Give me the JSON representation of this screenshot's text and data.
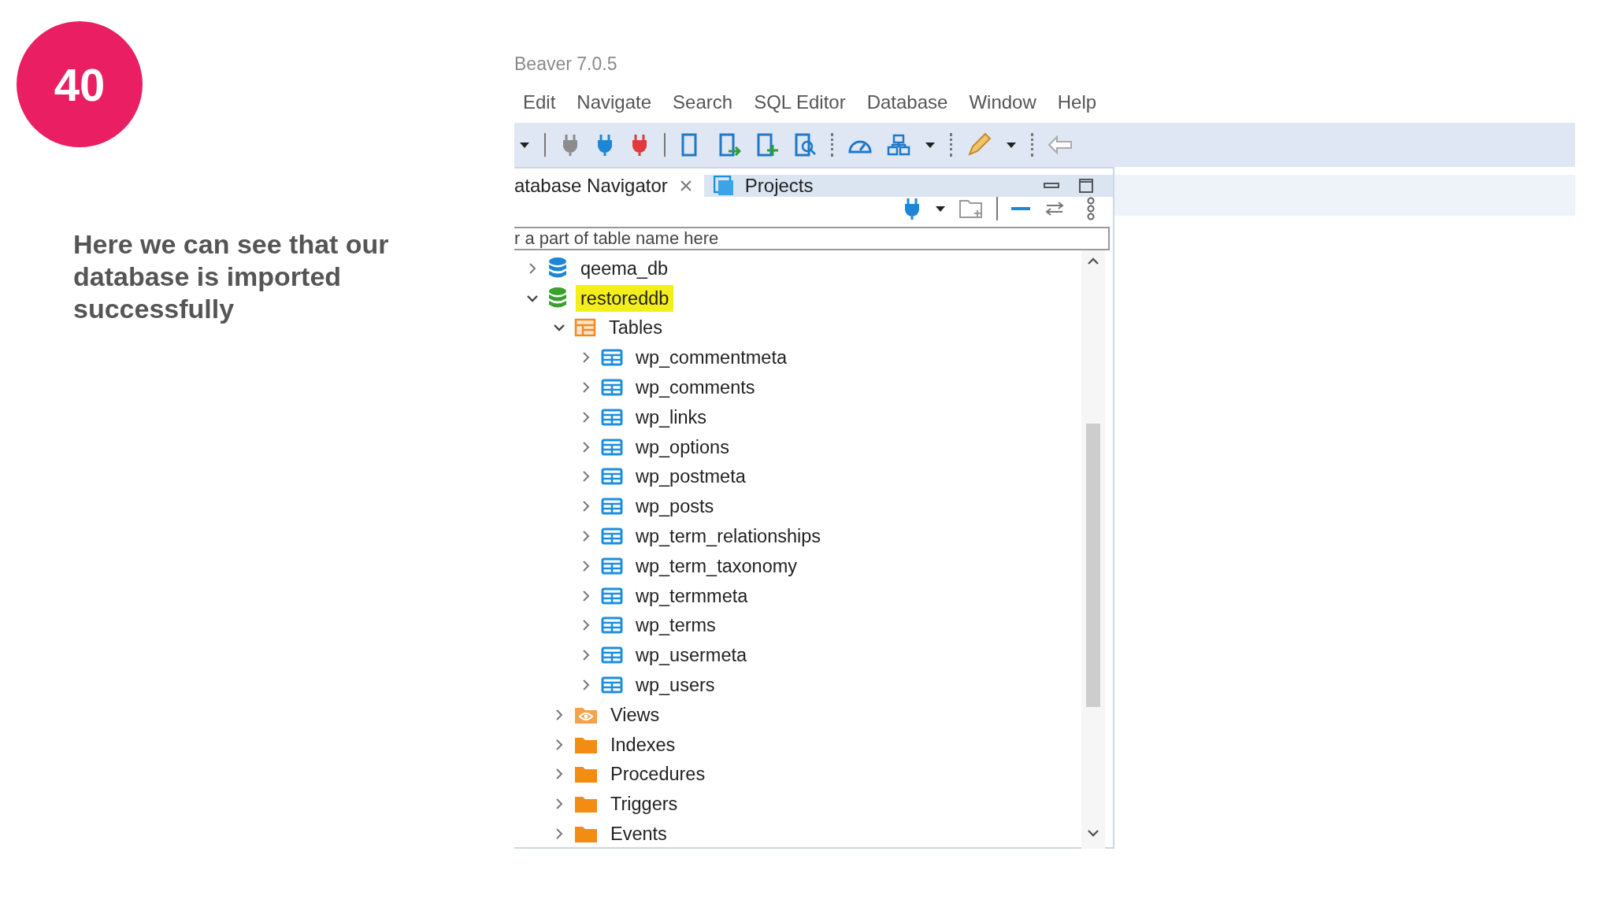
{
  "slide": {
    "number": "40",
    "caption": "Here we can see that our database is imported successfully"
  },
  "app": {
    "title": "Beaver 7.0.5",
    "menu": [
      "Edit",
      "Navigate",
      "Search",
      "SQL Editor",
      "Database",
      "Window",
      "Help"
    ],
    "tabs": [
      {
        "label": "atabase Navigator",
        "selected": true,
        "closable": true
      },
      {
        "label": "Projects",
        "selected": false,
        "closable": false
      }
    ],
    "filter": {
      "placeholder": "r a part of table name here"
    },
    "tree": [
      {
        "label": "qeema_db",
        "kind": "database",
        "connected": false,
        "expanded": false,
        "highlighted": false
      },
      {
        "label": "restoreddb",
        "kind": "database",
        "connected": true,
        "expanded": true,
        "highlighted": true,
        "children": [
          {
            "label": "Tables",
            "kind": "tables",
            "expanded": true,
            "highlighted": false,
            "children": [
              {
                "label": "wp_commentmeta",
                "kind": "table",
                "expanded": false,
                "highlighted": false
              },
              {
                "label": "wp_comments",
                "kind": "table",
                "expanded": false,
                "highlighted": false
              },
              {
                "label": "wp_links",
                "kind": "table",
                "expanded": false,
                "highlighted": false
              },
              {
                "label": "wp_options",
                "kind": "table",
                "expanded": false,
                "highlighted": false
              },
              {
                "label": "wp_postmeta",
                "kind": "table",
                "expanded": false,
                "highlighted": false
              },
              {
                "label": "wp_posts",
                "kind": "table",
                "expanded": false,
                "highlighted": false
              },
              {
                "label": "wp_term_relationships",
                "kind": "table",
                "expanded": false,
                "highlighted": false
              },
              {
                "label": "wp_term_taxonomy",
                "kind": "table",
                "expanded": false,
                "highlighted": false
              },
              {
                "label": "wp_termmeta",
                "kind": "table",
                "expanded": false,
                "highlighted": false
              },
              {
                "label": "wp_terms",
                "kind": "table",
                "expanded": false,
                "highlighted": false
              },
              {
                "label": "wp_usermeta",
                "kind": "table",
                "expanded": false,
                "highlighted": false
              },
              {
                "label": "wp_users",
                "kind": "table",
                "expanded": false,
                "highlighted": false
              }
            ]
          },
          {
            "label": "Views",
            "kind": "views",
            "expanded": false,
            "highlighted": false
          },
          {
            "label": "Indexes",
            "kind": "folder",
            "expanded": false,
            "highlighted": false
          },
          {
            "label": "Procedures",
            "kind": "folder",
            "expanded": false,
            "highlighted": false
          },
          {
            "label": "Triggers",
            "kind": "folder",
            "expanded": false,
            "highlighted": false
          },
          {
            "label": "Events",
            "kind": "folder",
            "expanded": false,
            "highlighted": false
          }
        ]
      }
    ]
  }
}
